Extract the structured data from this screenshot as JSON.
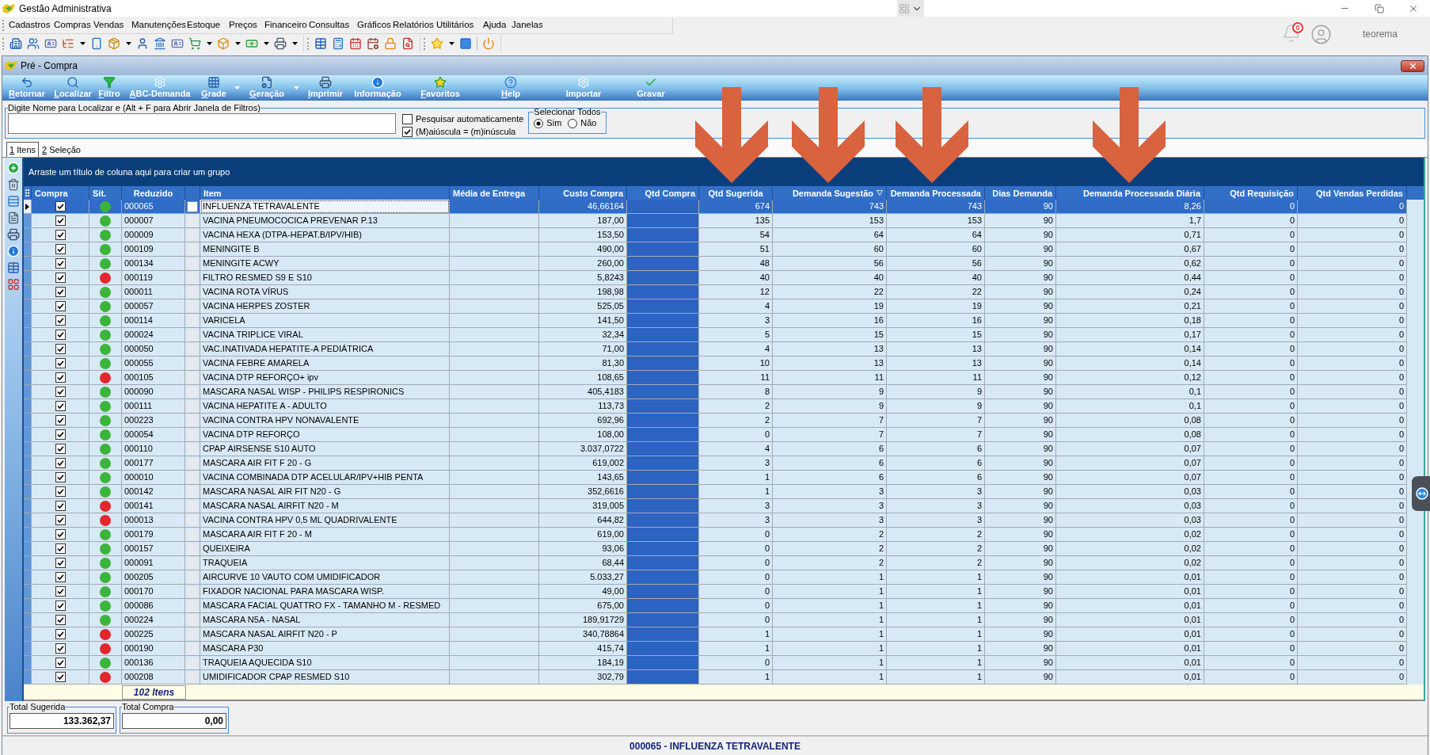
{
  "window": {
    "title": "Gestão Administrativa"
  },
  "menu": [
    "Cadastros",
    "Compras",
    "Vendas",
    "Manutenções",
    "Estoque",
    "Preços",
    "Financeiro",
    "Consultas",
    "Gráficos",
    "Relatórios",
    "Utilitários",
    "Ajuda",
    "Janelas"
  ],
  "user": {
    "notifications": "0",
    "name": "teorema"
  },
  "form": {
    "title": "Pré - Compra"
  },
  "toolbar": [
    {
      "label": "Retornar",
      "accelerator": true,
      "dropdown": false
    },
    {
      "label": "Localizar",
      "accelerator": true,
      "dropdown": false
    },
    {
      "label": "Filtro",
      "accelerator": true,
      "dropdown": false
    },
    {
      "label": "ABC-Demanda",
      "accelerator": true,
      "dropdown": false
    },
    {
      "label": "Grade",
      "accelerator": true,
      "dropdown": true
    },
    {
      "label": "Geração",
      "accelerator": true,
      "dropdown": true
    },
    {
      "label": "Imprimir",
      "accelerator": true,
      "dropdown": false
    },
    {
      "label": "Informação",
      "accelerator": false,
      "dropdown": false
    },
    {
      "label": "Favoritos",
      "accelerator": true,
      "dropdown": false
    },
    {
      "label": "Help",
      "accelerator": true,
      "dropdown": false
    },
    {
      "label": "Importar",
      "accelerator": false,
      "dropdown": false
    },
    {
      "label": "Gravar",
      "accelerator": false,
      "dropdown": false
    }
  ],
  "search": {
    "label": "Digite Nome para Localizar e (Alt + F para Abrir Janela de Filtros)",
    "options": [
      {
        "label": "Pesquisar automaticamente",
        "checked": false
      },
      {
        "label": "(M)aiúscula = (m)inúscula",
        "checked": true
      }
    ]
  },
  "select_all": {
    "label": "Selecionar Todos",
    "options": [
      {
        "label": "Sim",
        "selected": true
      },
      {
        "label": "Não",
        "selected": false
      }
    ]
  },
  "tabs": [
    {
      "label": "1 Itens",
      "selected": true
    },
    {
      "label": "2 Seleção",
      "selected": false
    }
  ],
  "group_panel": {
    "hint": "Arraste um título de coluna aqui para criar um grupo"
  },
  "table": {
    "columns": [
      {
        "label": "Compra",
        "sorted": false
      },
      {
        "label": "Sit.",
        "sorted": false
      },
      {
        "label": "Reduzido",
        "sorted": false
      },
      {
        "label": "Item",
        "sorted": false
      },
      {
        "label": "Média de Entrega",
        "sorted": false
      },
      {
        "label": "Custo Compra",
        "sorted": false
      },
      {
        "label": "Qtd Compra",
        "sorted": false
      },
      {
        "label": "Qtd Sugerida",
        "sorted": false
      },
      {
        "label": "Demanda Sugestão",
        "sorted": true
      },
      {
        "label": "Demanda Processada",
        "sorted": false
      },
      {
        "label": "Dias Demanda",
        "sorted": false
      },
      {
        "label": "Demanda Processada Diária",
        "sorted": false
      },
      {
        "label": "Qtd Requisição",
        "sorted": false
      },
      {
        "label": "Qtd Vendas Perdidas",
        "sorted": false
      }
    ],
    "rows": [
      {
        "selected": true,
        "compra": true,
        "color": "#3cb43c",
        "reduzido": "000065",
        "item": "INFLUENZA TETRAVALENTE",
        "custo_compra": "46,66164",
        "qtd_sugerida": "674",
        "demanda_sugestao": "743",
        "demanda_processada": "743",
        "dias_demanda": "90",
        "demanda_processada_diaria": "8,26",
        "qtd_requisicao": "0",
        "qtd_vendas_perdidas": "0"
      },
      {
        "selected": false,
        "compra": true,
        "color": "#3cb43c",
        "reduzido": "000007",
        "item": "VACINA PNEUMOCOCICA PREVENAR P.13",
        "custo_compra": "187,00",
        "qtd_sugerida": "135",
        "demanda_sugestao": "153",
        "demanda_processada": "153",
        "dias_demanda": "90",
        "demanda_processada_diaria": "1,7",
        "qtd_requisicao": "0",
        "qtd_vendas_perdidas": "0"
      },
      {
        "selected": false,
        "compra": true,
        "color": "#3cb43c",
        "reduzido": "000009",
        "item": "VACINA HEXA (DTPA-HEPAT.B/IPV/HIB)",
        "custo_compra": "153,50",
        "qtd_sugerida": "54",
        "demanda_sugestao": "64",
        "demanda_processada": "64",
        "dias_demanda": "90",
        "demanda_processada_diaria": "0,71",
        "qtd_requisicao": "0",
        "qtd_vendas_perdidas": "0"
      },
      {
        "selected": false,
        "compra": true,
        "color": "#3cb43c",
        "reduzido": "000109",
        "item": "MENINGITE B",
        "custo_compra": "490,00",
        "qtd_sugerida": "51",
        "demanda_sugestao": "60",
        "demanda_processada": "60",
        "dias_demanda": "90",
        "demanda_processada_diaria": "0,67",
        "qtd_requisicao": "0",
        "qtd_vendas_perdidas": "0"
      },
      {
        "selected": false,
        "compra": true,
        "color": "#3cb43c",
        "reduzido": "000134",
        "item": "MENINGITE ACWY",
        "custo_compra": "260,00",
        "qtd_sugerida": "48",
        "demanda_sugestao": "56",
        "demanda_processada": "56",
        "dias_demanda": "90",
        "demanda_processada_diaria": "0,62",
        "qtd_requisicao": "0",
        "qtd_vendas_perdidas": "0"
      },
      {
        "selected": false,
        "compra": true,
        "color": "#e3262e",
        "reduzido": "000119",
        "item": "FILTRO RESMED S9 E S10",
        "custo_compra": "5,8243",
        "qtd_sugerida": "40",
        "demanda_sugestao": "40",
        "demanda_processada": "40",
        "dias_demanda": "90",
        "demanda_processada_diaria": "0,44",
        "qtd_requisicao": "0",
        "qtd_vendas_perdidas": "0"
      },
      {
        "selected": false,
        "compra": true,
        "color": "#3cb43c",
        "reduzido": "000011",
        "item": "VACINA ROTA VÍRUS",
        "custo_compra": "198,98",
        "qtd_sugerida": "12",
        "demanda_sugestao": "22",
        "demanda_processada": "22",
        "dias_demanda": "90",
        "demanda_processada_diaria": "0,24",
        "qtd_requisicao": "0",
        "qtd_vendas_perdidas": "0"
      },
      {
        "selected": false,
        "compra": true,
        "color": "#3cb43c",
        "reduzido": "000057",
        "item": "VACINA HERPES ZOSTER",
        "custo_compra": "525,05",
        "qtd_sugerida": "4",
        "demanda_sugestao": "19",
        "demanda_processada": "19",
        "dias_demanda": "90",
        "demanda_processada_diaria": "0,21",
        "qtd_requisicao": "0",
        "qtd_vendas_perdidas": "0"
      },
      {
        "selected": false,
        "compra": true,
        "color": "#3cb43c",
        "reduzido": "000114",
        "item": "VARICELA",
        "custo_compra": "141,50",
        "qtd_sugerida": "3",
        "demanda_sugestao": "16",
        "demanda_processada": "16",
        "dias_demanda": "90",
        "demanda_processada_diaria": "0,18",
        "qtd_requisicao": "0",
        "qtd_vendas_perdidas": "0"
      },
      {
        "selected": false,
        "compra": true,
        "color": "#3cb43c",
        "reduzido": "000024",
        "item": "VACINA TRIPLICE VIRAL",
        "custo_compra": "32,34",
        "qtd_sugerida": "5",
        "demanda_sugestao": "15",
        "demanda_processada": "15",
        "dias_demanda": "90",
        "demanda_processada_diaria": "0,17",
        "qtd_requisicao": "0",
        "qtd_vendas_perdidas": "0"
      },
      {
        "selected": false,
        "compra": true,
        "color": "#3cb43c",
        "reduzido": "000050",
        "item": "VAC.INATIVADA HEPATITE-A PEDIÁTRICA",
        "custo_compra": "71,00",
        "qtd_sugerida": "4",
        "demanda_sugestao": "13",
        "demanda_processada": "13",
        "dias_demanda": "90",
        "demanda_processada_diaria": "0,14",
        "qtd_requisicao": "0",
        "qtd_vendas_perdidas": "0"
      },
      {
        "selected": false,
        "compra": true,
        "color": "#3cb43c",
        "reduzido": "000055",
        "item": "VACINA FEBRE AMARELA",
        "custo_compra": "81,30",
        "qtd_sugerida": "10",
        "demanda_sugestao": "13",
        "demanda_processada": "13",
        "dias_demanda": "90",
        "demanda_processada_diaria": "0,14",
        "qtd_requisicao": "0",
        "qtd_vendas_perdidas": "0"
      },
      {
        "selected": false,
        "compra": true,
        "color": "#e3262e",
        "reduzido": "000105",
        "item": "VACINA DTP REFORÇO+ ipv",
        "custo_compra": "108,65",
        "qtd_sugerida": "11",
        "demanda_sugestao": "11",
        "demanda_processada": "11",
        "dias_demanda": "90",
        "demanda_processada_diaria": "0,12",
        "qtd_requisicao": "0",
        "qtd_vendas_perdidas": "0"
      },
      {
        "selected": false,
        "compra": true,
        "color": "#3cb43c",
        "reduzido": "000090",
        "item": "MASCARA NASAL WISP - PHILIPS RESPIRONICS",
        "custo_compra": "405,4183",
        "qtd_sugerida": "8",
        "demanda_sugestao": "9",
        "demanda_processada": "9",
        "dias_demanda": "90",
        "demanda_processada_diaria": "0,1",
        "qtd_requisicao": "0",
        "qtd_vendas_perdidas": "0"
      },
      {
        "selected": false,
        "compra": true,
        "color": "#3cb43c",
        "reduzido": "000111",
        "item": "VACINA HEPATITE A - ADULTO",
        "custo_compra": "113,73",
        "qtd_sugerida": "2",
        "demanda_sugestao": "9",
        "demanda_processada": "9",
        "dias_demanda": "90",
        "demanda_processada_diaria": "0,1",
        "qtd_requisicao": "0",
        "qtd_vendas_perdidas": "0"
      },
      {
        "selected": false,
        "compra": true,
        "color": "#3cb43c",
        "reduzido": "000223",
        "item": "VACINA CONTRA HPV NONAVALENTE",
        "custo_compra": "692,96",
        "qtd_sugerida": "2",
        "demanda_sugestao": "7",
        "demanda_processada": "7",
        "dias_demanda": "90",
        "demanda_processada_diaria": "0,08",
        "qtd_requisicao": "0",
        "qtd_vendas_perdidas": "0"
      },
      {
        "selected": false,
        "compra": true,
        "color": "#3cb43c",
        "reduzido": "000054",
        "item": "VACINA DTP REFORÇO",
        "custo_compra": "108,00",
        "qtd_sugerida": "0",
        "demanda_sugestao": "7",
        "demanda_processada": "7",
        "dias_demanda": "90",
        "demanda_processada_diaria": "0,08",
        "qtd_requisicao": "0",
        "qtd_vendas_perdidas": "0"
      },
      {
        "selected": false,
        "compra": true,
        "color": "#3cb43c",
        "reduzido": "000110",
        "item": "CPAP AIRSENSE S10 AUTO",
        "custo_compra": "3.037,0722",
        "qtd_sugerida": "4",
        "demanda_sugestao": "6",
        "demanda_processada": "6",
        "dias_demanda": "90",
        "demanda_processada_diaria": "0,07",
        "qtd_requisicao": "0",
        "qtd_vendas_perdidas": "0"
      },
      {
        "selected": false,
        "compra": true,
        "color": "#3cb43c",
        "reduzido": "000177",
        "item": "MASCARA AIR FIT F 20 - G",
        "custo_compra": "619,002",
        "qtd_sugerida": "3",
        "demanda_sugestao": "6",
        "demanda_processada": "6",
        "dias_demanda": "90",
        "demanda_processada_diaria": "0,07",
        "qtd_requisicao": "0",
        "qtd_vendas_perdidas": "0"
      },
      {
        "selected": false,
        "compra": true,
        "color": "#3cb43c",
        "reduzido": "000010",
        "item": "VACINA COMBINADA DTP ACELULAR/IPV+HIB PENTA",
        "custo_compra": "143,65",
        "qtd_sugerida": "1",
        "demanda_sugestao": "6",
        "demanda_processada": "6",
        "dias_demanda": "90",
        "demanda_processada_diaria": "0,07",
        "qtd_requisicao": "0",
        "qtd_vendas_perdidas": "0"
      },
      {
        "selected": false,
        "compra": true,
        "color": "#3cb43c",
        "reduzido": "000142",
        "item": "MASCARA NASAL AIR FIT N20 - G",
        "custo_compra": "352,6616",
        "qtd_sugerida": "1",
        "demanda_sugestao": "3",
        "demanda_processada": "3",
        "dias_demanda": "90",
        "demanda_processada_diaria": "0,03",
        "qtd_requisicao": "0",
        "qtd_vendas_perdidas": "0"
      },
      {
        "selected": false,
        "compra": true,
        "color": "#e3262e",
        "reduzido": "000141",
        "item": "MASCARA NASAL AIRFIT N20 - M",
        "custo_compra": "319,005",
        "qtd_sugerida": "3",
        "demanda_sugestao": "3",
        "demanda_processada": "3",
        "dias_demanda": "90",
        "demanda_processada_diaria": "0,03",
        "qtd_requisicao": "0",
        "qtd_vendas_perdidas": "0"
      },
      {
        "selected": false,
        "compra": true,
        "color": "#e3262e",
        "reduzido": "000013",
        "item": "VACINA CONTRA HPV 0,5 ML QUADRIVALENTE",
        "custo_compra": "644,82",
        "qtd_sugerida": "3",
        "demanda_sugestao": "3",
        "demanda_processada": "3",
        "dias_demanda": "90",
        "demanda_processada_diaria": "0,03",
        "qtd_requisicao": "0",
        "qtd_vendas_perdidas": "0"
      },
      {
        "selected": false,
        "compra": true,
        "color": "#3cb43c",
        "reduzido": "000179",
        "item": "MASCARA AIR FIT F 20 - M",
        "custo_compra": "619,00",
        "qtd_sugerida": "0",
        "demanda_sugestao": "2",
        "demanda_processada": "2",
        "dias_demanda": "90",
        "demanda_processada_diaria": "0,02",
        "qtd_requisicao": "0",
        "qtd_vendas_perdidas": "0"
      },
      {
        "selected": false,
        "compra": true,
        "color": "#3cb43c",
        "reduzido": "000157",
        "item": "QUEIXEIRA",
        "custo_compra": "93,06",
        "qtd_sugerida": "0",
        "demanda_sugestao": "2",
        "demanda_processada": "2",
        "dias_demanda": "90",
        "demanda_processada_diaria": "0,02",
        "qtd_requisicao": "0",
        "qtd_vendas_perdidas": "0"
      },
      {
        "selected": false,
        "compra": true,
        "color": "#3cb43c",
        "reduzido": "000091",
        "item": "TRAQUEIA",
        "custo_compra": "68,44",
        "qtd_sugerida": "0",
        "demanda_sugestao": "2",
        "demanda_processada": "2",
        "dias_demanda": "90",
        "demanda_processada_diaria": "0,02",
        "qtd_requisicao": "0",
        "qtd_vendas_perdidas": "0"
      },
      {
        "selected": false,
        "compra": true,
        "color": "#3cb43c",
        "reduzido": "000205",
        "item": "AIRCURVE 10 VAUTO COM UMIDIFICADOR",
        "custo_compra": "5.033,27",
        "qtd_sugerida": "0",
        "demanda_sugestao": "1",
        "demanda_processada": "1",
        "dias_demanda": "90",
        "demanda_processada_diaria": "0,01",
        "qtd_requisicao": "0",
        "qtd_vendas_perdidas": "0"
      },
      {
        "selected": false,
        "compra": true,
        "color": "#3cb43c",
        "reduzido": "000170",
        "item": "FIXADOR NACIONAL PARA MASCARA WISP.",
        "custo_compra": "49,00",
        "qtd_sugerida": "0",
        "demanda_sugestao": "1",
        "demanda_processada": "1",
        "dias_demanda": "90",
        "demanda_processada_diaria": "0,01",
        "qtd_requisicao": "0",
        "qtd_vendas_perdidas": "0"
      },
      {
        "selected": false,
        "compra": true,
        "color": "#3cb43c",
        "reduzido": "000086",
        "item": "MASCARA FACIAL QUATTRO FX - TAMANHO M - RESMED",
        "custo_compra": "675,00",
        "qtd_sugerida": "0",
        "demanda_sugestao": "1",
        "demanda_processada": "1",
        "dias_demanda": "90",
        "demanda_processada_diaria": "0,01",
        "qtd_requisicao": "0",
        "qtd_vendas_perdidas": "0"
      },
      {
        "selected": false,
        "compra": true,
        "color": "#3cb43c",
        "reduzido": "000224",
        "item": "MASCARA N5A - NASAL",
        "custo_compra": "189,91729",
        "qtd_sugerida": "0",
        "demanda_sugestao": "1",
        "demanda_processada": "1",
        "dias_demanda": "90",
        "demanda_processada_diaria": "0,01",
        "qtd_requisicao": "0",
        "qtd_vendas_perdidas": "0"
      },
      {
        "selected": false,
        "compra": true,
        "color": "#e3262e",
        "reduzido": "000225",
        "item": "MASCARA NASAL AIRFIT N20 - P",
        "custo_compra": "340,78864",
        "qtd_sugerida": "1",
        "demanda_sugestao": "1",
        "demanda_processada": "1",
        "dias_demanda": "90",
        "demanda_processada_diaria": "0,01",
        "qtd_requisicao": "0",
        "qtd_vendas_perdidas": "0"
      },
      {
        "selected": false,
        "compra": true,
        "color": "#e3262e",
        "reduzido": "000190",
        "item": "MASCARA P30",
        "custo_compra": "415,74",
        "qtd_sugerida": "1",
        "demanda_sugestao": "1",
        "demanda_processada": "1",
        "dias_demanda": "90",
        "demanda_processada_diaria": "0,01",
        "qtd_requisicao": "0",
        "qtd_vendas_perdidas": "0"
      },
      {
        "selected": false,
        "compra": true,
        "color": "#3cb43c",
        "reduzido": "000136",
        "item": "TRAQUEIA AQUECIDA S10",
        "custo_compra": "184,19",
        "qtd_sugerida": "0",
        "demanda_sugestao": "1",
        "demanda_processada": "1",
        "dias_demanda": "90",
        "demanda_processada_diaria": "0,01",
        "qtd_requisicao": "0",
        "qtd_vendas_perdidas": "0"
      },
      {
        "selected": false,
        "compra": true,
        "color": "#e3262e",
        "reduzido": "000208",
        "item": "UMIDIFICADOR CPAP RESMED S10",
        "custo_compra": "302,79",
        "qtd_sugerida": "1",
        "demanda_sugestao": "1",
        "demanda_processada": "1",
        "dias_demanda": "90",
        "demanda_processada_diaria": "0,01",
        "qtd_requisicao": "0",
        "qtd_vendas_perdidas": "0"
      }
    ],
    "footer": {
      "count": "102 Itens"
    }
  },
  "totals": [
    {
      "label": "Total Sugerida",
      "value": "133.362,37"
    },
    {
      "label": "Total Compra",
      "value": "0,00"
    }
  ],
  "status_bar": {
    "text": "000065 - INFLUENZA TETRAVALENTE"
  }
}
